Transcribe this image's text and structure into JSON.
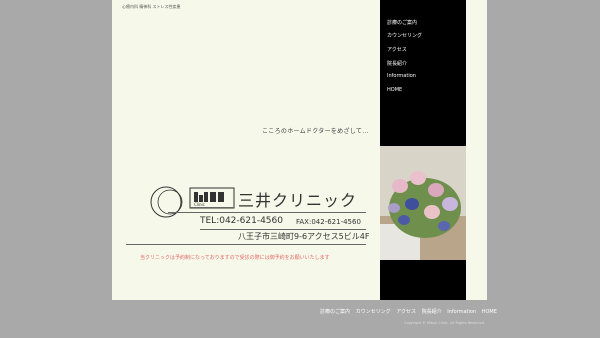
{
  "header": {
    "tagline": "心療内科 精神科 ストレス性疾患"
  },
  "nav": {
    "items": [
      {
        "label": "診療のご案内"
      },
      {
        "label": "カウンセリング"
      },
      {
        "label": "アクセス"
      },
      {
        "label": "院長紹介"
      },
      {
        "label": "Information"
      },
      {
        "label": "HOME"
      }
    ]
  },
  "main": {
    "slogan": "こころのホームドクターをめざして…",
    "logo_text": "Clinic",
    "clinic_name": "三井クリニック",
    "tel": "TEL:042-621-4560",
    "fax": "FAX:042-621-4560",
    "address": "八王子市三崎町9-6アクセス5ビル4F",
    "notice": "当クリニックは予約制になっておりますので受診の際には御予約をお願いいたします",
    "accent_color": "#e26a6a"
  },
  "footer": {
    "links": [
      {
        "label": "診療のご案内"
      },
      {
        "label": "カウンセリング"
      },
      {
        "label": "アクセス"
      },
      {
        "label": "院長紹介"
      },
      {
        "label": "Information"
      },
      {
        "label": "HOME"
      }
    ],
    "copyright": "Copyright © Mitsui Clinic. All Rights Reserved."
  }
}
